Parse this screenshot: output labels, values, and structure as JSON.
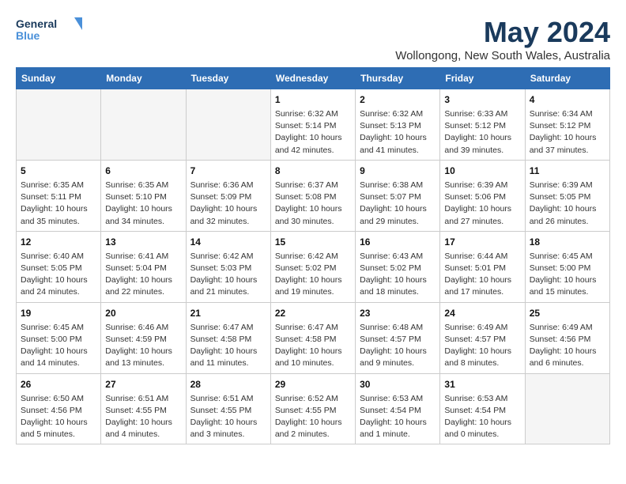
{
  "header": {
    "logo_line1": "General",
    "logo_line2": "Blue",
    "month_year": "May 2024",
    "location": "Wollongong, New South Wales, Australia"
  },
  "weekdays": [
    "Sunday",
    "Monday",
    "Tuesday",
    "Wednesday",
    "Thursday",
    "Friday",
    "Saturday"
  ],
  "weeks": [
    [
      {
        "day": "",
        "info": ""
      },
      {
        "day": "",
        "info": ""
      },
      {
        "day": "",
        "info": ""
      },
      {
        "day": "1",
        "info": "Sunrise: 6:32 AM\nSunset: 5:14 PM\nDaylight: 10 hours\nand 42 minutes."
      },
      {
        "day": "2",
        "info": "Sunrise: 6:32 AM\nSunset: 5:13 PM\nDaylight: 10 hours\nand 41 minutes."
      },
      {
        "day": "3",
        "info": "Sunrise: 6:33 AM\nSunset: 5:12 PM\nDaylight: 10 hours\nand 39 minutes."
      },
      {
        "day": "4",
        "info": "Sunrise: 6:34 AM\nSunset: 5:12 PM\nDaylight: 10 hours\nand 37 minutes."
      }
    ],
    [
      {
        "day": "5",
        "info": "Sunrise: 6:35 AM\nSunset: 5:11 PM\nDaylight: 10 hours\nand 35 minutes."
      },
      {
        "day": "6",
        "info": "Sunrise: 6:35 AM\nSunset: 5:10 PM\nDaylight: 10 hours\nand 34 minutes."
      },
      {
        "day": "7",
        "info": "Sunrise: 6:36 AM\nSunset: 5:09 PM\nDaylight: 10 hours\nand 32 minutes."
      },
      {
        "day": "8",
        "info": "Sunrise: 6:37 AM\nSunset: 5:08 PM\nDaylight: 10 hours\nand 30 minutes."
      },
      {
        "day": "9",
        "info": "Sunrise: 6:38 AM\nSunset: 5:07 PM\nDaylight: 10 hours\nand 29 minutes."
      },
      {
        "day": "10",
        "info": "Sunrise: 6:39 AM\nSunset: 5:06 PM\nDaylight: 10 hours\nand 27 minutes."
      },
      {
        "day": "11",
        "info": "Sunrise: 6:39 AM\nSunset: 5:05 PM\nDaylight: 10 hours\nand 26 minutes."
      }
    ],
    [
      {
        "day": "12",
        "info": "Sunrise: 6:40 AM\nSunset: 5:05 PM\nDaylight: 10 hours\nand 24 minutes."
      },
      {
        "day": "13",
        "info": "Sunrise: 6:41 AM\nSunset: 5:04 PM\nDaylight: 10 hours\nand 22 minutes."
      },
      {
        "day": "14",
        "info": "Sunrise: 6:42 AM\nSunset: 5:03 PM\nDaylight: 10 hours\nand 21 minutes."
      },
      {
        "day": "15",
        "info": "Sunrise: 6:42 AM\nSunset: 5:02 PM\nDaylight: 10 hours\nand 19 minutes."
      },
      {
        "day": "16",
        "info": "Sunrise: 6:43 AM\nSunset: 5:02 PM\nDaylight: 10 hours\nand 18 minutes."
      },
      {
        "day": "17",
        "info": "Sunrise: 6:44 AM\nSunset: 5:01 PM\nDaylight: 10 hours\nand 17 minutes."
      },
      {
        "day": "18",
        "info": "Sunrise: 6:45 AM\nSunset: 5:00 PM\nDaylight: 10 hours\nand 15 minutes."
      }
    ],
    [
      {
        "day": "19",
        "info": "Sunrise: 6:45 AM\nSunset: 5:00 PM\nDaylight: 10 hours\nand 14 minutes."
      },
      {
        "day": "20",
        "info": "Sunrise: 6:46 AM\nSunset: 4:59 PM\nDaylight: 10 hours\nand 13 minutes."
      },
      {
        "day": "21",
        "info": "Sunrise: 6:47 AM\nSunset: 4:58 PM\nDaylight: 10 hours\nand 11 minutes."
      },
      {
        "day": "22",
        "info": "Sunrise: 6:47 AM\nSunset: 4:58 PM\nDaylight: 10 hours\nand 10 minutes."
      },
      {
        "day": "23",
        "info": "Sunrise: 6:48 AM\nSunset: 4:57 PM\nDaylight: 10 hours\nand 9 minutes."
      },
      {
        "day": "24",
        "info": "Sunrise: 6:49 AM\nSunset: 4:57 PM\nDaylight: 10 hours\nand 8 minutes."
      },
      {
        "day": "25",
        "info": "Sunrise: 6:49 AM\nSunset: 4:56 PM\nDaylight: 10 hours\nand 6 minutes."
      }
    ],
    [
      {
        "day": "26",
        "info": "Sunrise: 6:50 AM\nSunset: 4:56 PM\nDaylight: 10 hours\nand 5 minutes."
      },
      {
        "day": "27",
        "info": "Sunrise: 6:51 AM\nSunset: 4:55 PM\nDaylight: 10 hours\nand 4 minutes."
      },
      {
        "day": "28",
        "info": "Sunrise: 6:51 AM\nSunset: 4:55 PM\nDaylight: 10 hours\nand 3 minutes."
      },
      {
        "day": "29",
        "info": "Sunrise: 6:52 AM\nSunset: 4:55 PM\nDaylight: 10 hours\nand 2 minutes."
      },
      {
        "day": "30",
        "info": "Sunrise: 6:53 AM\nSunset: 4:54 PM\nDaylight: 10 hours\nand 1 minute."
      },
      {
        "day": "31",
        "info": "Sunrise: 6:53 AM\nSunset: 4:54 PM\nDaylight: 10 hours\nand 0 minutes."
      },
      {
        "day": "",
        "info": ""
      }
    ]
  ]
}
